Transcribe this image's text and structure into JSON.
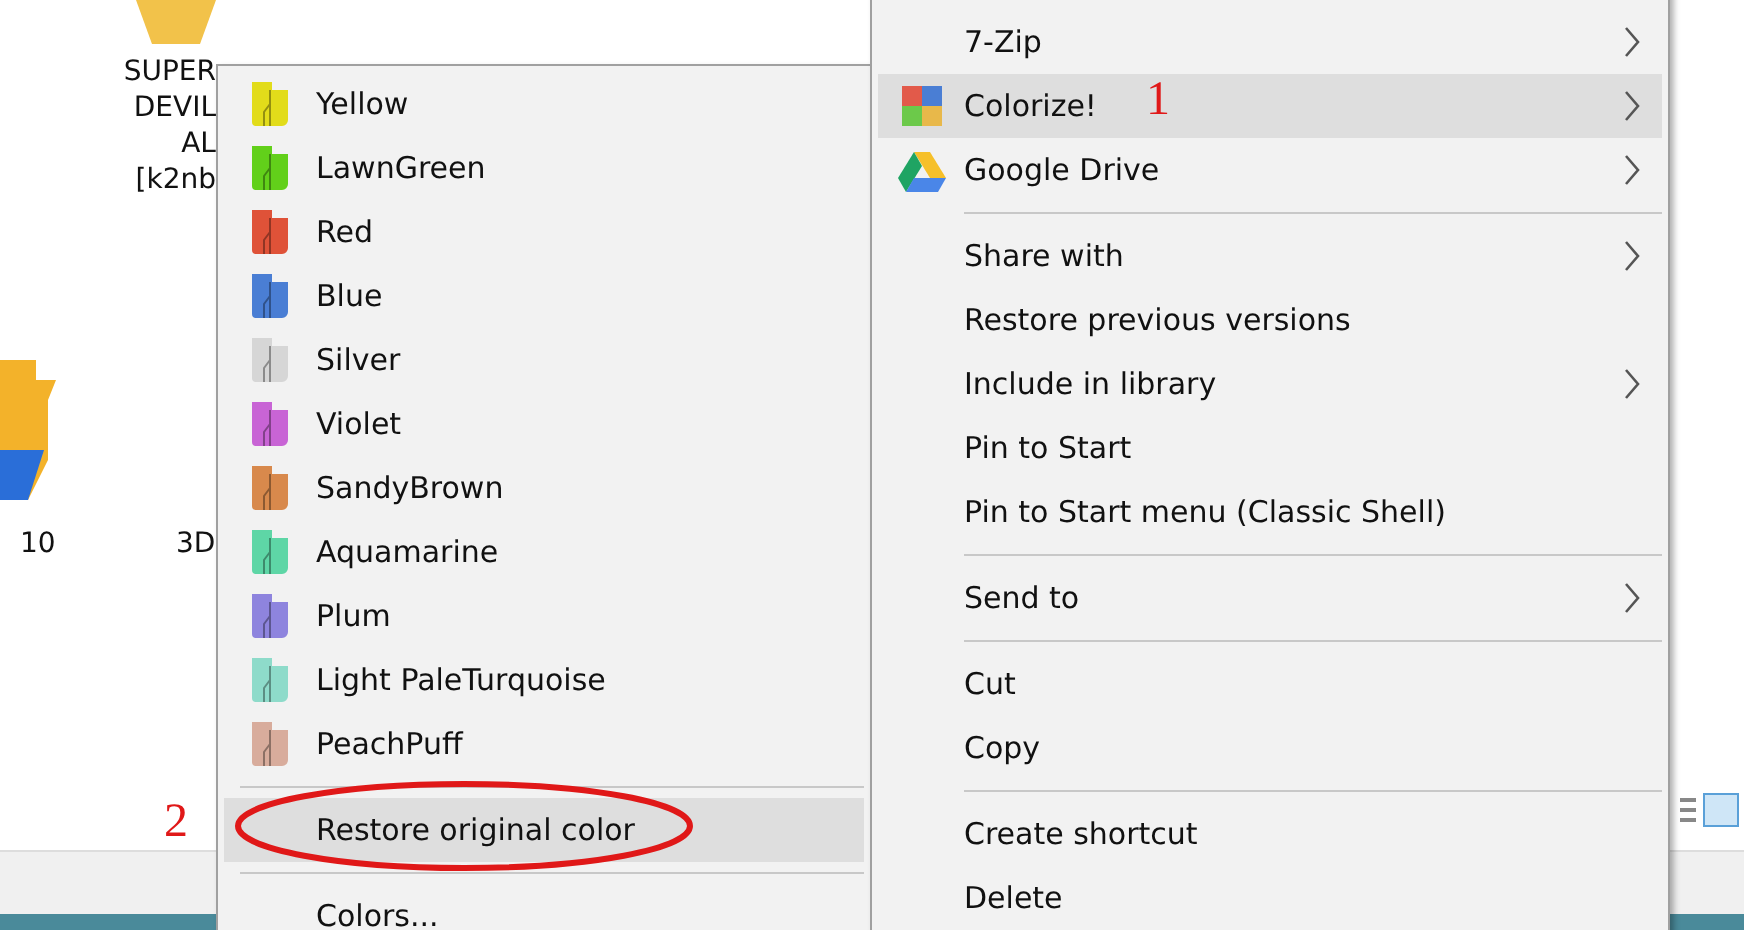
{
  "explorer": {
    "file_labels": [
      {
        "lines": [
          "SUPER",
          "DEVIL",
          "AL",
          "[k2nb"
        ]
      },
      {
        "lines": [
          "10"
        ]
      },
      {
        "lines": [
          "3D"
        ]
      }
    ]
  },
  "colorize_submenu": {
    "items": [
      {
        "kind": "color",
        "label": "Yellow",
        "color": "#e2dc1a"
      },
      {
        "kind": "color",
        "label": "LawnGreen",
        "color": "#62d01a"
      },
      {
        "kind": "color",
        "label": "Red",
        "color": "#df5238"
      },
      {
        "kind": "color",
        "label": "Blue",
        "color": "#4a7ed4"
      },
      {
        "kind": "color",
        "label": "Silver",
        "color": "#d6d6d6"
      },
      {
        "kind": "color",
        "label": "Violet",
        "color": "#c864d5"
      },
      {
        "kind": "color",
        "label": "SandyBrown",
        "color": "#d8894c"
      },
      {
        "kind": "color",
        "label": "Aquamarine",
        "color": "#5ed6a6"
      },
      {
        "kind": "color",
        "label": "Plum",
        "color": "#8e84de"
      },
      {
        "kind": "color",
        "label": "Light PaleTurquoise",
        "color": "#8edbca"
      },
      {
        "kind": "color",
        "label": "PeachPuff",
        "color": "#d8ac9c"
      },
      {
        "kind": "separator"
      },
      {
        "kind": "action",
        "label": "Restore original color",
        "selected": true
      },
      {
        "kind": "separator"
      },
      {
        "kind": "action",
        "label": "Colors...",
        "selected": false
      }
    ]
  },
  "context_menu": {
    "items": [
      {
        "kind": "item",
        "label": "7-Zip",
        "submenu": true,
        "selected": false
      },
      {
        "kind": "item",
        "label": "Colorize!",
        "submenu": true,
        "selected": true
      },
      {
        "kind": "item",
        "label": "Google Drive",
        "submenu": true,
        "selected": false
      },
      {
        "kind": "separator"
      },
      {
        "kind": "item",
        "label": "Share with",
        "submenu": true,
        "selected": false
      },
      {
        "kind": "item",
        "label": "Restore previous versions",
        "submenu": false,
        "selected": false
      },
      {
        "kind": "item",
        "label": "Include in library",
        "submenu": true,
        "selected": false
      },
      {
        "kind": "item",
        "label": "Pin to Start",
        "submenu": false,
        "selected": false
      },
      {
        "kind": "item",
        "label": "Pin to Start menu (Classic Shell)",
        "submenu": false,
        "selected": false
      },
      {
        "kind": "separator"
      },
      {
        "kind": "item",
        "label": "Send to",
        "submenu": true,
        "selected": false
      },
      {
        "kind": "separator"
      },
      {
        "kind": "item",
        "label": "Cut",
        "submenu": false,
        "selected": false
      },
      {
        "kind": "item",
        "label": "Copy",
        "submenu": false,
        "selected": false
      },
      {
        "kind": "separator"
      },
      {
        "kind": "item",
        "label": "Create shortcut",
        "submenu": false,
        "selected": false
      },
      {
        "kind": "item",
        "label": "Delete",
        "submenu": false,
        "selected": false
      }
    ]
  },
  "annotations": [
    {
      "text": "1"
    },
    {
      "text": "2"
    }
  ]
}
